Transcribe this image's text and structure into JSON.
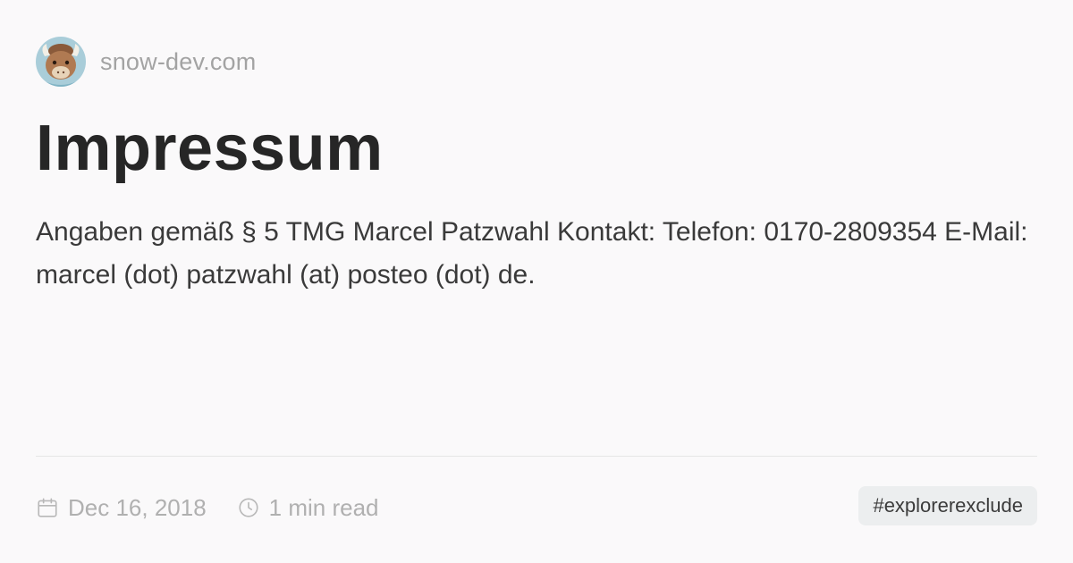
{
  "site": {
    "name": "snow-dev.com",
    "avatar_icon": "yak-mascot-icon"
  },
  "article": {
    "title": "Impressum",
    "description": "Angaben gemäß § 5 TMG Marcel Patzwahl Kontakt: Telefon: 0170-2809354 E-Mail: marcel (dot) patzwahl (at) posteo (dot) de."
  },
  "meta": {
    "date": "Dec 16, 2018",
    "date_icon": "calendar-icon",
    "read_time": "1 min read",
    "read_time_icon": "clock-icon"
  },
  "tags": [
    "#explorerexclude"
  ],
  "colors": {
    "background": "#faf9fa",
    "title": "#262626",
    "muted": "#a3a3a3",
    "tag_bg": "#eceeef"
  }
}
